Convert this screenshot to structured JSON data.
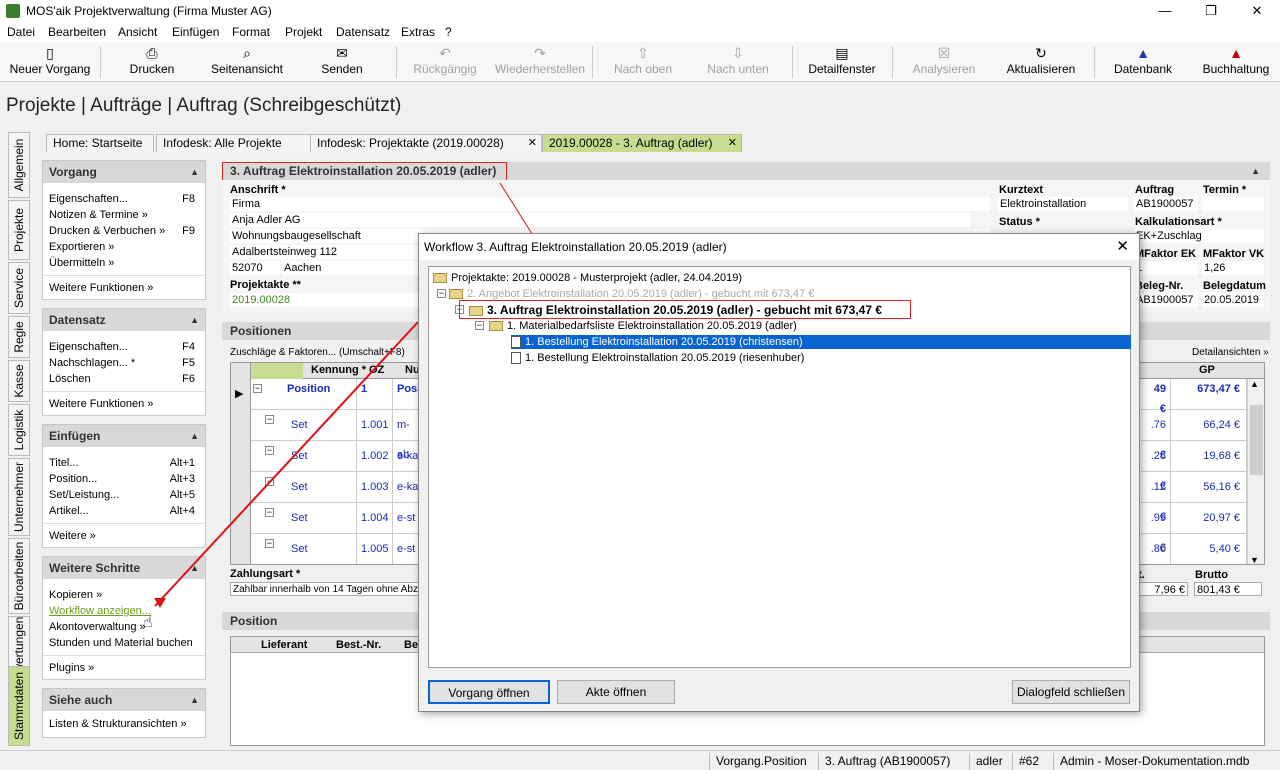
{
  "window": {
    "title": "MOS'aik Projektverwaltung (Firma Muster AG)",
    "min": "—",
    "max": "❐",
    "close": "✕"
  },
  "menu": [
    "Datei",
    "Bearbeiten",
    "Ansicht",
    "Einfügen",
    "Format",
    "Projekt",
    "Datensatz",
    "Extras",
    "?"
  ],
  "toolbar": [
    {
      "label": "Neuer Vorgang",
      "icon": "▯",
      "dis": false
    },
    {
      "label": "Drucken",
      "icon": "⎙",
      "dis": false
    },
    {
      "label": "Seitenansicht",
      "icon": "⌕",
      "dis": false
    },
    {
      "label": "Senden",
      "icon": "✉",
      "dis": false
    },
    {
      "label": "Rückgängig",
      "icon": "↶",
      "dis": true
    },
    {
      "label": "Wiederherstellen",
      "icon": "↷",
      "dis": true
    },
    {
      "label": "Nach oben",
      "icon": "⇧",
      "dis": true
    },
    {
      "label": "Nach unten",
      "icon": "⇩",
      "dis": true
    },
    {
      "label": "Detailfenster",
      "icon": "▤",
      "dis": false
    },
    {
      "label": "Analysieren",
      "icon": "☒",
      "dis": true
    },
    {
      "label": "Aktualisieren",
      "icon": "↻",
      "dis": false
    },
    {
      "label": "Datenbank",
      "icon": "▲",
      "dis": false
    },
    {
      "label": "Buchhaltung",
      "icon": "▲",
      "dis": false
    }
  ],
  "page_title": "Projekte | Aufträge | Auftrag (Schreibgeschützt)",
  "vtabs": [
    "Allgemein",
    "Projekte",
    "Service",
    "Regie",
    "Kasse",
    "Logistik",
    "Unternehmer",
    "Büroarbeiten",
    "Auswertungen",
    "Stammdaten"
  ],
  "tabs": [
    "Home: Startseite",
    "Infodesk: Alle Projekte",
    "Infodesk: Projektakte (2019.00028)",
    "2019.00028 - 3. Auftrag (adler)"
  ],
  "left": {
    "vorgang": {
      "title": "Vorgang",
      "items": [
        [
          "Eigenschaften...",
          "F8"
        ],
        [
          "Notizen & Termine »",
          ""
        ],
        [
          "Drucken & Verbuchen »",
          "F9"
        ],
        [
          "Exportieren »",
          ""
        ],
        [
          "Übermitteln »",
          ""
        ]
      ],
      "more": "Weitere Funktionen »"
    },
    "datensatz": {
      "title": "Datensatz",
      "items": [
        [
          "Eigenschaften...",
          "F4"
        ],
        [
          "Nachschlagen... *",
          "F5"
        ],
        [
          "Löschen",
          "F6"
        ]
      ],
      "more": "Weitere Funktionen »"
    },
    "einfuegen": {
      "title": "Einfügen",
      "items": [
        [
          "Titel...",
          "Alt+1"
        ],
        [
          "Position...",
          "Alt+3"
        ],
        [
          "Set/Leistung...",
          "Alt+5"
        ],
        [
          "Artikel...",
          "Alt+4"
        ]
      ],
      "more": "Weitere »"
    },
    "schritte": {
      "title": "Weitere Schritte",
      "items": [
        "Kopieren »",
        "Workflow anzeigen...",
        "Akontoverwaltung »",
        "Stunden und Material buchen"
      ],
      "more": "Plugins »"
    },
    "siehe": {
      "title": "Siehe auch",
      "items": [
        "Listen & Strukturansichten »"
      ]
    }
  },
  "doc": {
    "header": "3. Auftrag Elektroinstallation 20.05.2019 (adler)",
    "anschrift_label": "Anschrift *",
    "anschrift": [
      "Firma",
      "Anja Adler AG",
      "Wohnungsbaugesellschaft",
      "Adalbertsteinweg 112"
    ],
    "plz": "52070",
    "ort": "Aachen",
    "projektakte_label": "Projektakte **",
    "projektakte": "2019.00028",
    "kurztext_label": "Kurztext",
    "kurztext": "Elektroinstallation",
    "status_label": "Status *",
    "auftrag_label": "Auftrag",
    "auftrag": "AB1900057",
    "termin_label": "Termin *",
    "kalk_label": "Kalkulationsart *",
    "kalk": "EK+Zuschlag",
    "mfek_label": "MFaktor EK",
    "mfek": "1",
    "mfvk_label": "MFaktor VK",
    "mfvk": "1,26",
    "belegnr_label": "Beleg-Nr.",
    "belegnr": "AB1900057",
    "belegdatum_label": "Belegdatum",
    "belegdatum": "20.05.2019",
    "positionen": "Positionen",
    "zuschlag": "Zuschläge & Faktoren... (Umschalt+F8)",
    "detail": "Detailansichten »",
    "cols": [
      "Kennung *",
      "OZ",
      "Nu",
      "GP"
    ],
    "rows": [
      {
        "k": "Position",
        "oz": "1",
        "nu": "Posi",
        "p": "49 €",
        "gp": "673,47 €"
      },
      {
        "k": "Set",
        "oz": "1.001",
        "nu": "m-ab",
        "p": ".76 €",
        "gp": "66,24 €"
      },
      {
        "k": "Set",
        "oz": "1.002",
        "nu": "e-ka",
        "p": ".28 €",
        "gp": "19,68 €"
      },
      {
        "k": "Set",
        "oz": "1.003",
        "nu": "e-ka",
        "p": ".12 €",
        "gp": "56,16 €"
      },
      {
        "k": "Set",
        "oz": "1.004",
        "nu": "e-st",
        "p": ".99 €",
        "gp": "20,97 €"
      },
      {
        "k": "Set",
        "oz": "1.005",
        "nu": "e-st",
        "p": ".80 €",
        "gp": "5,40 €"
      }
    ],
    "zahlungsart_label": "Zahlungsart *",
    "zahlungsart": "Zahlbar innerhalb von 14 Tagen ohne Abzug",
    "netto_label": "t.",
    "netto": "7,96 €",
    "brutto_label": "Brutto",
    "brutto": "801,43 €",
    "position_hd": "Position",
    "lcols": [
      "Lieferant",
      "Best.-Nr.",
      "Be"
    ]
  },
  "dialog": {
    "title": "Workflow 3. Auftrag Elektroinstallation 20.05.2019 (adler)",
    "close": "✕",
    "n0": "Projektakte: 2019.00028 - Musterprojekt (adler, 24.04.2019)",
    "n1": "2. Angebot Elektroinstallation 20.05.2019 (adler) - gebucht mit 673,47 €",
    "n2": "3. Auftrag Elektroinstallation 20.05.2019 (adler) - gebucht mit 673,47 €",
    "n3": "1. Materialbedarfsliste Elektroinstallation 20.05.2019 (adler)",
    "n4": "1. Bestellung Elektroinstallation 20.05.2019 (christensen)",
    "n5": "1. Bestellung Elektroinstallation 20.05.2019 (riesenhuber)",
    "btn_vorgang": "Vorgang öffnen",
    "btn_akte": "Akte öffnen",
    "btn_close": "Dialogfeld schließen"
  },
  "status": [
    "Vorgang.Position",
    "3. Auftrag (AB1900057)",
    "adler",
    "#62",
    "Admin - Moser-Dokumentation.mdb"
  ]
}
